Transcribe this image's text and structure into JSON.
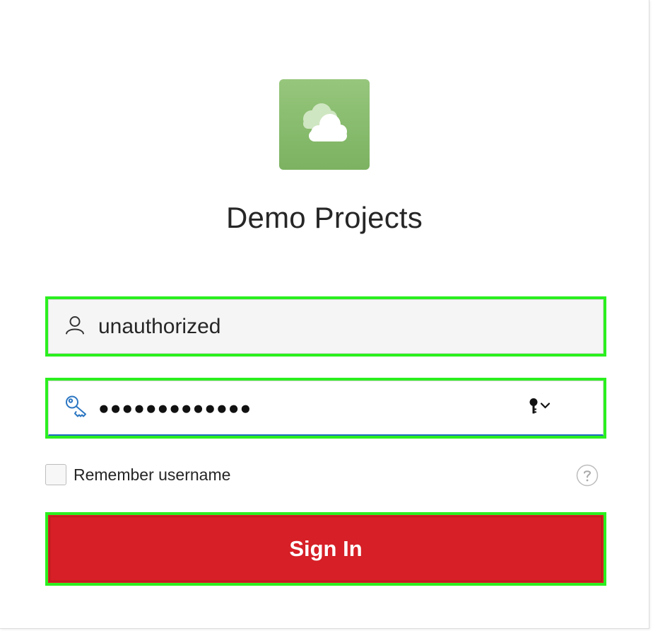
{
  "app": {
    "title": "Demo Projects",
    "icon": "cloud-icon",
    "accent_color": "#7cb261"
  },
  "login": {
    "username": {
      "value": "unauthorized",
      "icon": "user-icon"
    },
    "password": {
      "masked_value": "●●●●●●●●●●●●●",
      "icon": "key-icon",
      "autofill_icon": "keychain-icon"
    },
    "remember": {
      "label": "Remember username",
      "checked": false
    },
    "help_icon": "question-circle-icon",
    "sign_in": {
      "label": "Sign In",
      "color": "#d61f26"
    }
  }
}
